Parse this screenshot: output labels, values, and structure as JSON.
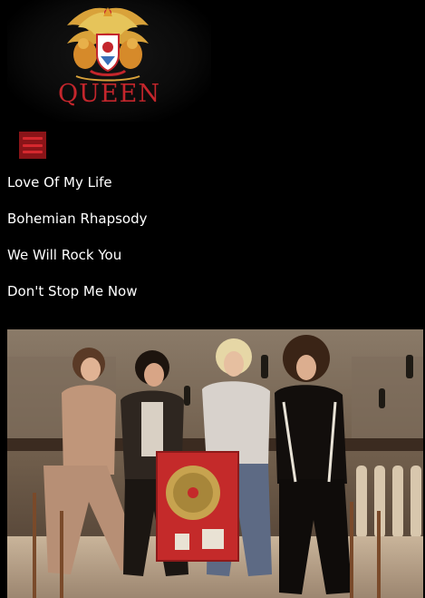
{
  "logo": {
    "wordmark": "QUEEN",
    "crest_icon": "queen-crest-icon"
  },
  "menu": {
    "icon": "hamburger-icon"
  },
  "nav": {
    "items": [
      {
        "label": "Love Of My Life"
      },
      {
        "label": "Bohemian Rhapsody"
      },
      {
        "label": "We Will Rock You"
      },
      {
        "label": "Don't Stop Me Now"
      }
    ]
  },
  "photo": {
    "subject": "band-photo"
  },
  "colors": {
    "background": "#000000",
    "accent": "#c4262c",
    "menu_bg": "#8a1418",
    "text": "#ffffff"
  }
}
